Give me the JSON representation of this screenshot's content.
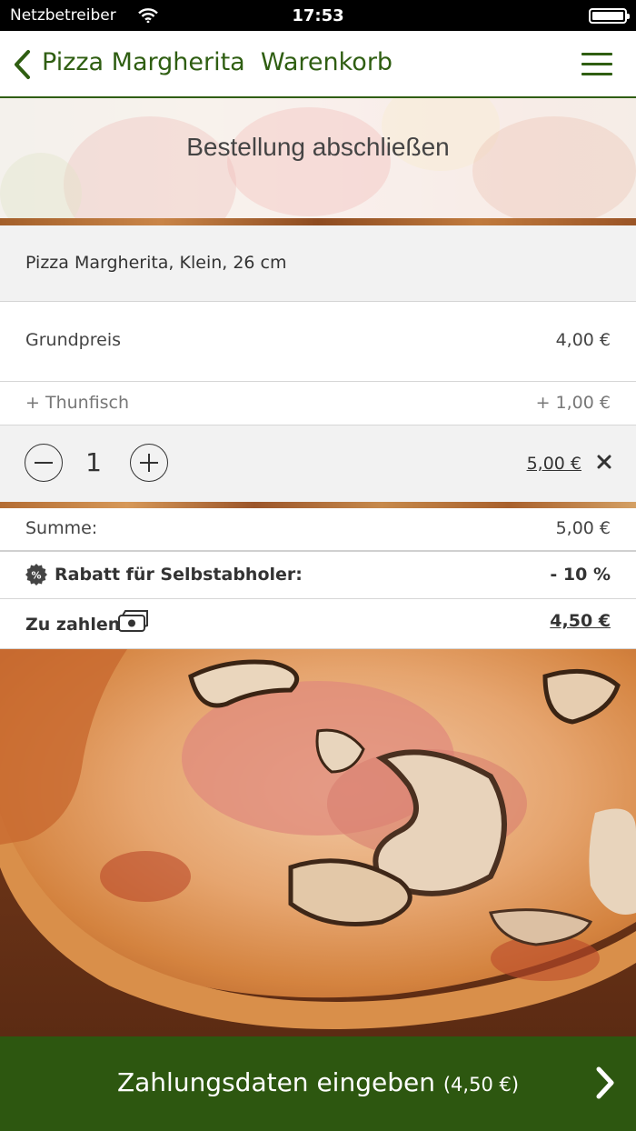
{
  "status_bar": {
    "carrier": "Netzbetreiber",
    "time": "17:53"
  },
  "nav": {
    "title": "Pizza Margherita  Warenkorb"
  },
  "banner": {
    "heading": "Bestellung abschließen"
  },
  "item": {
    "name": "Pizza Margherita, Klein, 26 cm",
    "base_price_label": "Grundpreis",
    "base_price": "4,00 €",
    "extra_label": "+ Thunfisch",
    "extra_price": "+ 1,00 €",
    "quantity": "1",
    "line_total": "5,00 €"
  },
  "summary": {
    "sum_label": "Summe:",
    "sum_value": "5,00 €",
    "discount_label": "Rabatt für Selbstabholer:",
    "discount_value": "- 10 %",
    "total_label": "Zu zahlen",
    "total_value": "4,50 €"
  },
  "footer": {
    "button_label": "Zahlungsdaten eingeben",
    "button_amount": "(4,50 €)"
  },
  "colors": {
    "brand_green": "#2f5e12",
    "footer_green": "#2d5710"
  },
  "icons": [
    "wifi-icon",
    "battery-icon",
    "back-chevron-icon",
    "hamburger-menu-icon",
    "minus-icon",
    "plus-icon",
    "close-icon",
    "percent-badge-icon",
    "cash-icon",
    "chevron-right-icon"
  ]
}
